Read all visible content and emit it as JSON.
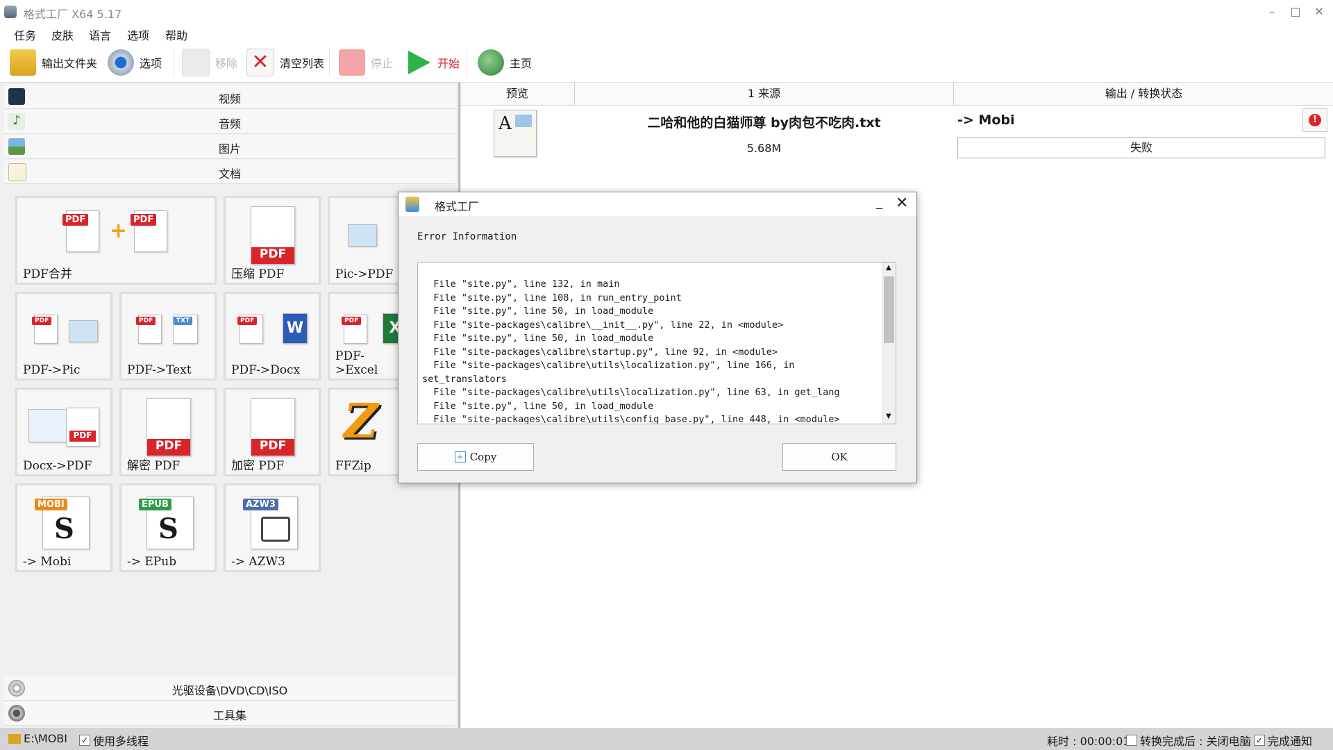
{
  "window": {
    "title": "格式工厂 X64 5.17"
  },
  "menu": [
    "任务",
    "皮肤",
    "语言",
    "选项",
    "帮助"
  ],
  "toolbar": {
    "output_folder": "输出文件夹",
    "options": "选项",
    "remove": "移除",
    "clear_list": "清空列表",
    "stop": "停止",
    "start": "开始",
    "home": "主页"
  },
  "categories": {
    "video": "视频",
    "audio": "音频",
    "image": "图片",
    "document": "文档"
  },
  "tiles": [
    {
      "label": "PDF合并"
    },
    {
      "label": "压缩 PDF"
    },
    {
      "label": "Pic->PDF"
    },
    {
      "label": "PDF->Pic"
    },
    {
      "label": "PDF->Text"
    },
    {
      "label": "PDF->Docx"
    },
    {
      "label": "PDF->Excel"
    },
    {
      "label": "Docx->PDF"
    },
    {
      "label": "解密 PDF"
    },
    {
      "label": "加密 PDF"
    },
    {
      "label": "FFZip"
    },
    {
      "label": "-> Mobi"
    },
    {
      "label": "-> EPub"
    },
    {
      "label": "-> AZW3"
    }
  ],
  "tile_icons": {
    "pdf": "PDF",
    "mobi": "MOBI",
    "epub": "EPUB",
    "azw3": "AZW3",
    "txt": "TXT",
    "w": "W",
    "x": "X"
  },
  "bottom_sections": {
    "optical": "光驱设备\\DVD\\CD\\ISO",
    "tools": "工具集"
  },
  "task_table": {
    "headers": {
      "preview": "预览",
      "source": "1 来源",
      "output": "输出 / 转换状态"
    },
    "rows": [
      {
        "filename": "二哈和他的白猫师尊 by肉包不吃肉.txt",
        "size": "5.68M",
        "target": "-> Mobi",
        "status": "失败"
      }
    ]
  },
  "statusbar": {
    "output_path": "E:\\MOBI",
    "multithread": "使用多线程",
    "elapsed": "耗时 : 00:00:01",
    "after_convert": "转换完成后 : 关闭电脑",
    "notify": "完成通知"
  },
  "dialog": {
    "title": "格式工厂",
    "heading": "Error Information",
    "log_lines": [
      "  File \"site.py\", line 132, in main",
      "  File \"site.py\", line 108, in run_entry_point",
      "  File \"site.py\", line 50, in load_module",
      "  File \"site-packages\\calibre\\__init__.py\", line 22, in <module>",
      "  File \"site.py\", line 50, in load_module",
      "  File \"site-packages\\calibre\\startup.py\", line 92, in <module>",
      "  File \"site-packages\\calibre\\utils\\localization.py\", line 166, in",
      "set_translators",
      "  File \"site-packages\\calibre\\utils\\localization.py\", line 63, in get_lang",
      "  File \"site.py\", line 50, in load_module",
      "  File \"site-packages\\calibre\\utils\\config_base.py\", line 448, in <module>"
    ],
    "copy_label": "Copy",
    "ok_label": "OK"
  },
  "colors": {
    "accent_red": "#d9252a",
    "play_green": "#2db34a",
    "dialog_bg": "#f0f0f0"
  }
}
